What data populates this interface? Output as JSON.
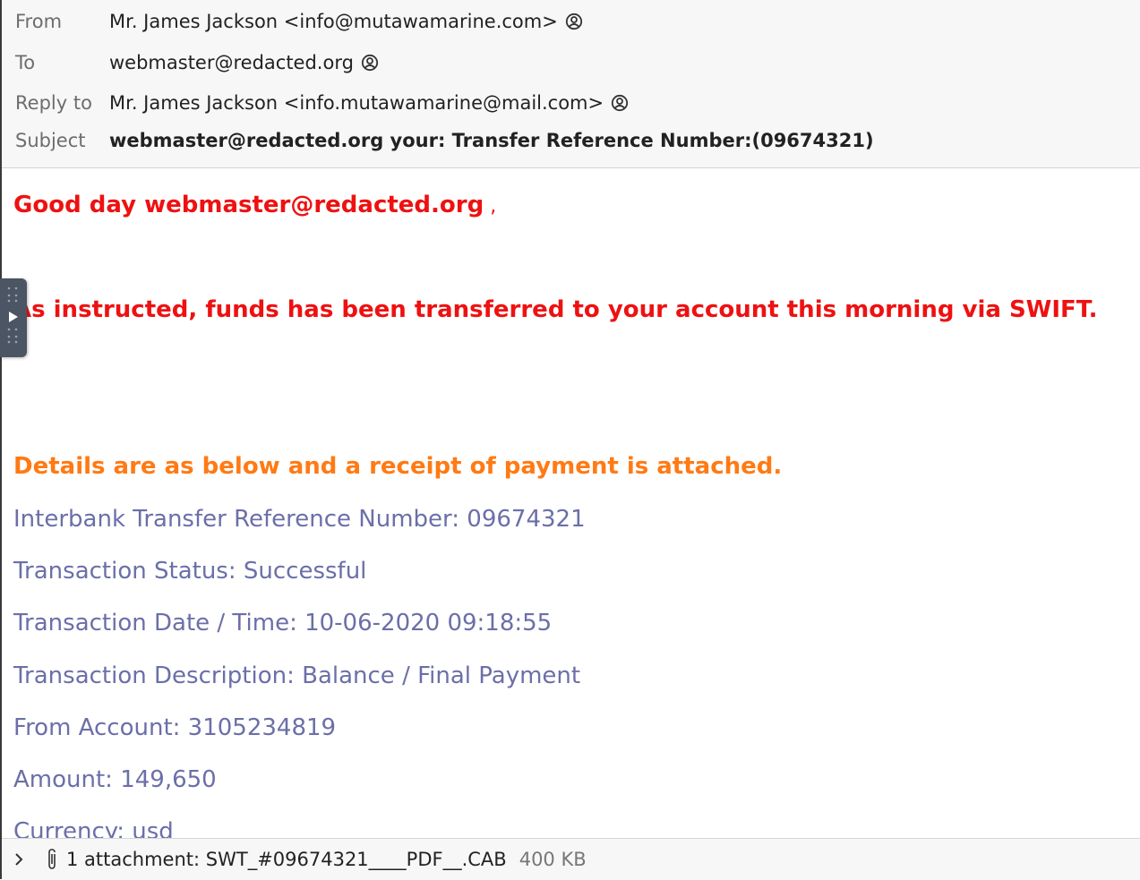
{
  "header": {
    "from_label": "From",
    "from_value": "Mr. James Jackson <info@mutawamarine.com>",
    "to_label": "To",
    "to_value": "webmaster@redacted.org",
    "replyto_label": "Reply to",
    "replyto_value": "Mr. James Jackson <info.mutawamarine@mail.com>",
    "subject_label": "Subject",
    "subject_value": "webmaster@redacted.org your: Transfer Reference Number:(09674321)"
  },
  "message": {
    "greeting": "Good day webmaster@redacted.org",
    "greeting_comma": " ,",
    "instruction": "As instructed, funds has been transferred to your account this morning via SWIFT.",
    "details_intro": "Details are as below and a receipt of payment is attached.",
    "lines": [
      "Interbank Transfer Reference Number: 09674321",
      "Transaction Status: Successful",
      "Transaction Date / Time: 10-06-2020 09:18:55",
      "Transaction Description: Balance / Final Payment",
      "From Account: 3105234819",
      "Amount: 149,650",
      "Currency: usd"
    ]
  },
  "attachment": {
    "summary": "1 attachment: SWT_#09674321____PDF__.CAB",
    "size": "400 KB"
  },
  "colors": {
    "greeting": "#ee1111",
    "details": "#ff7a14",
    "info": "#6b6fa8"
  },
  "icons": [
    "contact-icon",
    "play-icon",
    "chevron-right-icon",
    "paperclip-icon"
  ]
}
